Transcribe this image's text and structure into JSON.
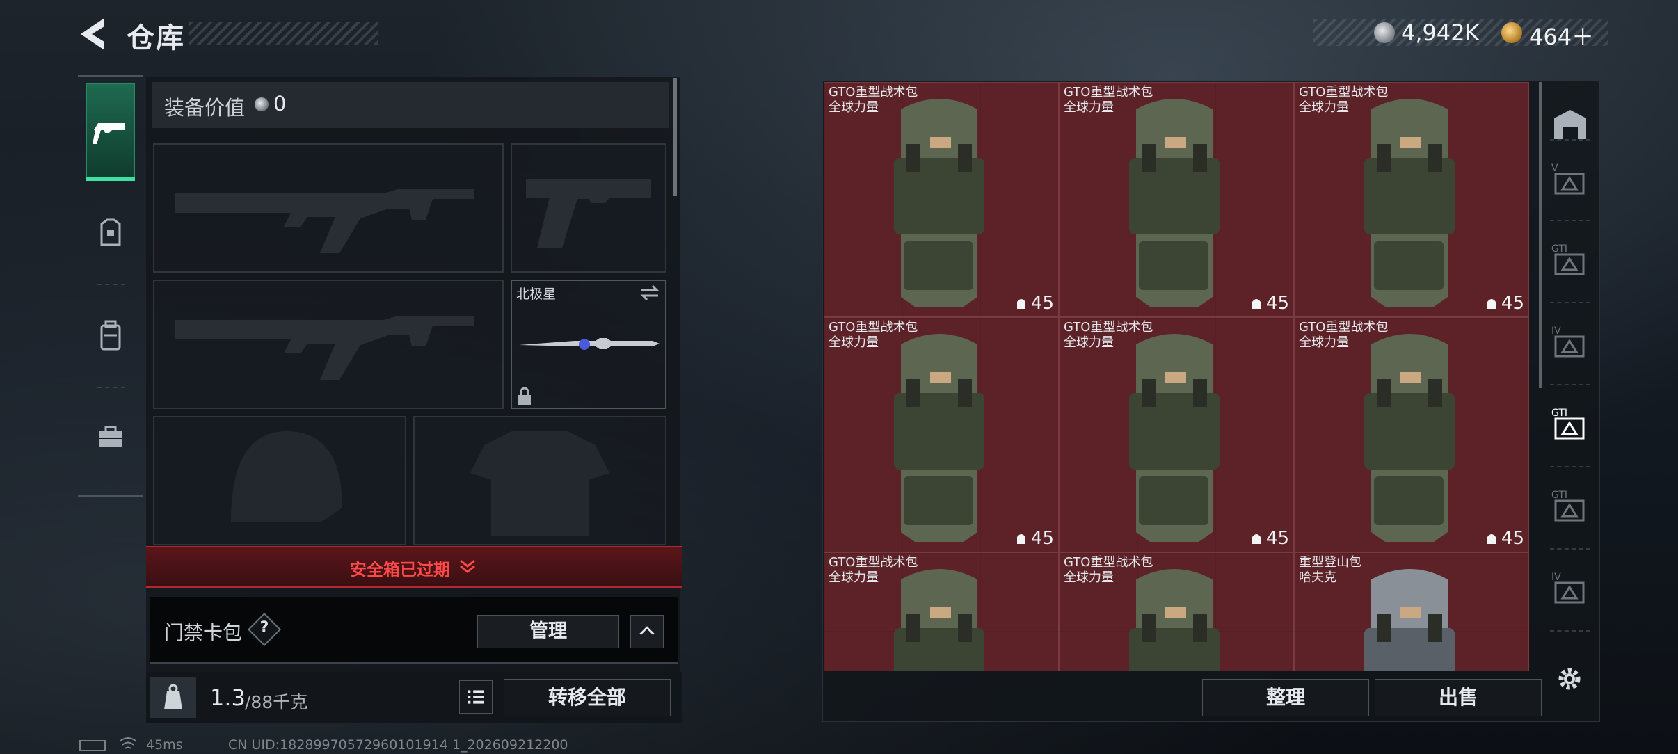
{
  "header": {
    "title": "仓库",
    "currency_silver": "4,942K",
    "currency_gold": "464＋"
  },
  "loadout": {
    "value_label": "装备价值",
    "value_amount": "0",
    "melee_name": "北极星",
    "safe_box_text": "安全箱已过期",
    "keycard_label": "门禁卡包",
    "help_mark": "?",
    "manage_label": "管理",
    "weight_value": "1.3",
    "weight_max": "/88千克",
    "transfer_label": "转移全部"
  },
  "storage": {
    "items": [
      {
        "name": "GTO重型战术包",
        "brand": "全球力量",
        "capacity": "45",
        "kind": "green"
      },
      {
        "name": "GTO重型战术包",
        "brand": "全球力量",
        "capacity": "45",
        "kind": "green"
      },
      {
        "name": "GTO重型战术包",
        "brand": "全球力量",
        "capacity": "45",
        "kind": "green"
      },
      {
        "name": "GTO重型战术包",
        "brand": "全球力量",
        "capacity": "45",
        "kind": "green"
      },
      {
        "name": "GTO重型战术包",
        "brand": "全球力量",
        "capacity": "45",
        "kind": "green"
      },
      {
        "name": "GTO重型战术包",
        "brand": "全球力量",
        "capacity": "45",
        "kind": "green"
      },
      {
        "name": "GTO重型战术包",
        "brand": "全球力量",
        "capacity": "",
        "kind": "green"
      },
      {
        "name": "GTO重型战术包",
        "brand": "全球力量",
        "capacity": "",
        "kind": "green"
      },
      {
        "name": "重型登山包",
        "brand": "哈夫克",
        "capacity": "",
        "kind": "grey"
      }
    ],
    "sort_label": "整理",
    "sell_label": "出售",
    "category_marks": [
      "V",
      "GTI",
      "IV",
      "GTI",
      "GTI",
      "IV"
    ]
  },
  "status": {
    "ping": "45ms",
    "uid": "CN UID:18289970572960101914 1_202609212200"
  },
  "colors": {
    "accent_green": "#3fe0a0",
    "danger_red": "#ff4a4a",
    "item_bg": "#5c2228"
  },
  "icons": [
    "back-arrow-icon",
    "silver-coin-icon",
    "gold-coin-icon",
    "pistol-icon",
    "armor-icon",
    "backpack-icon",
    "toolbox-icon",
    "swap-icon",
    "lock-icon",
    "chevron-down-icon",
    "help-icon",
    "chevron-up-icon",
    "weight-icon",
    "list-icon",
    "settings-icon",
    "battery-icon",
    "wifi-icon"
  ]
}
